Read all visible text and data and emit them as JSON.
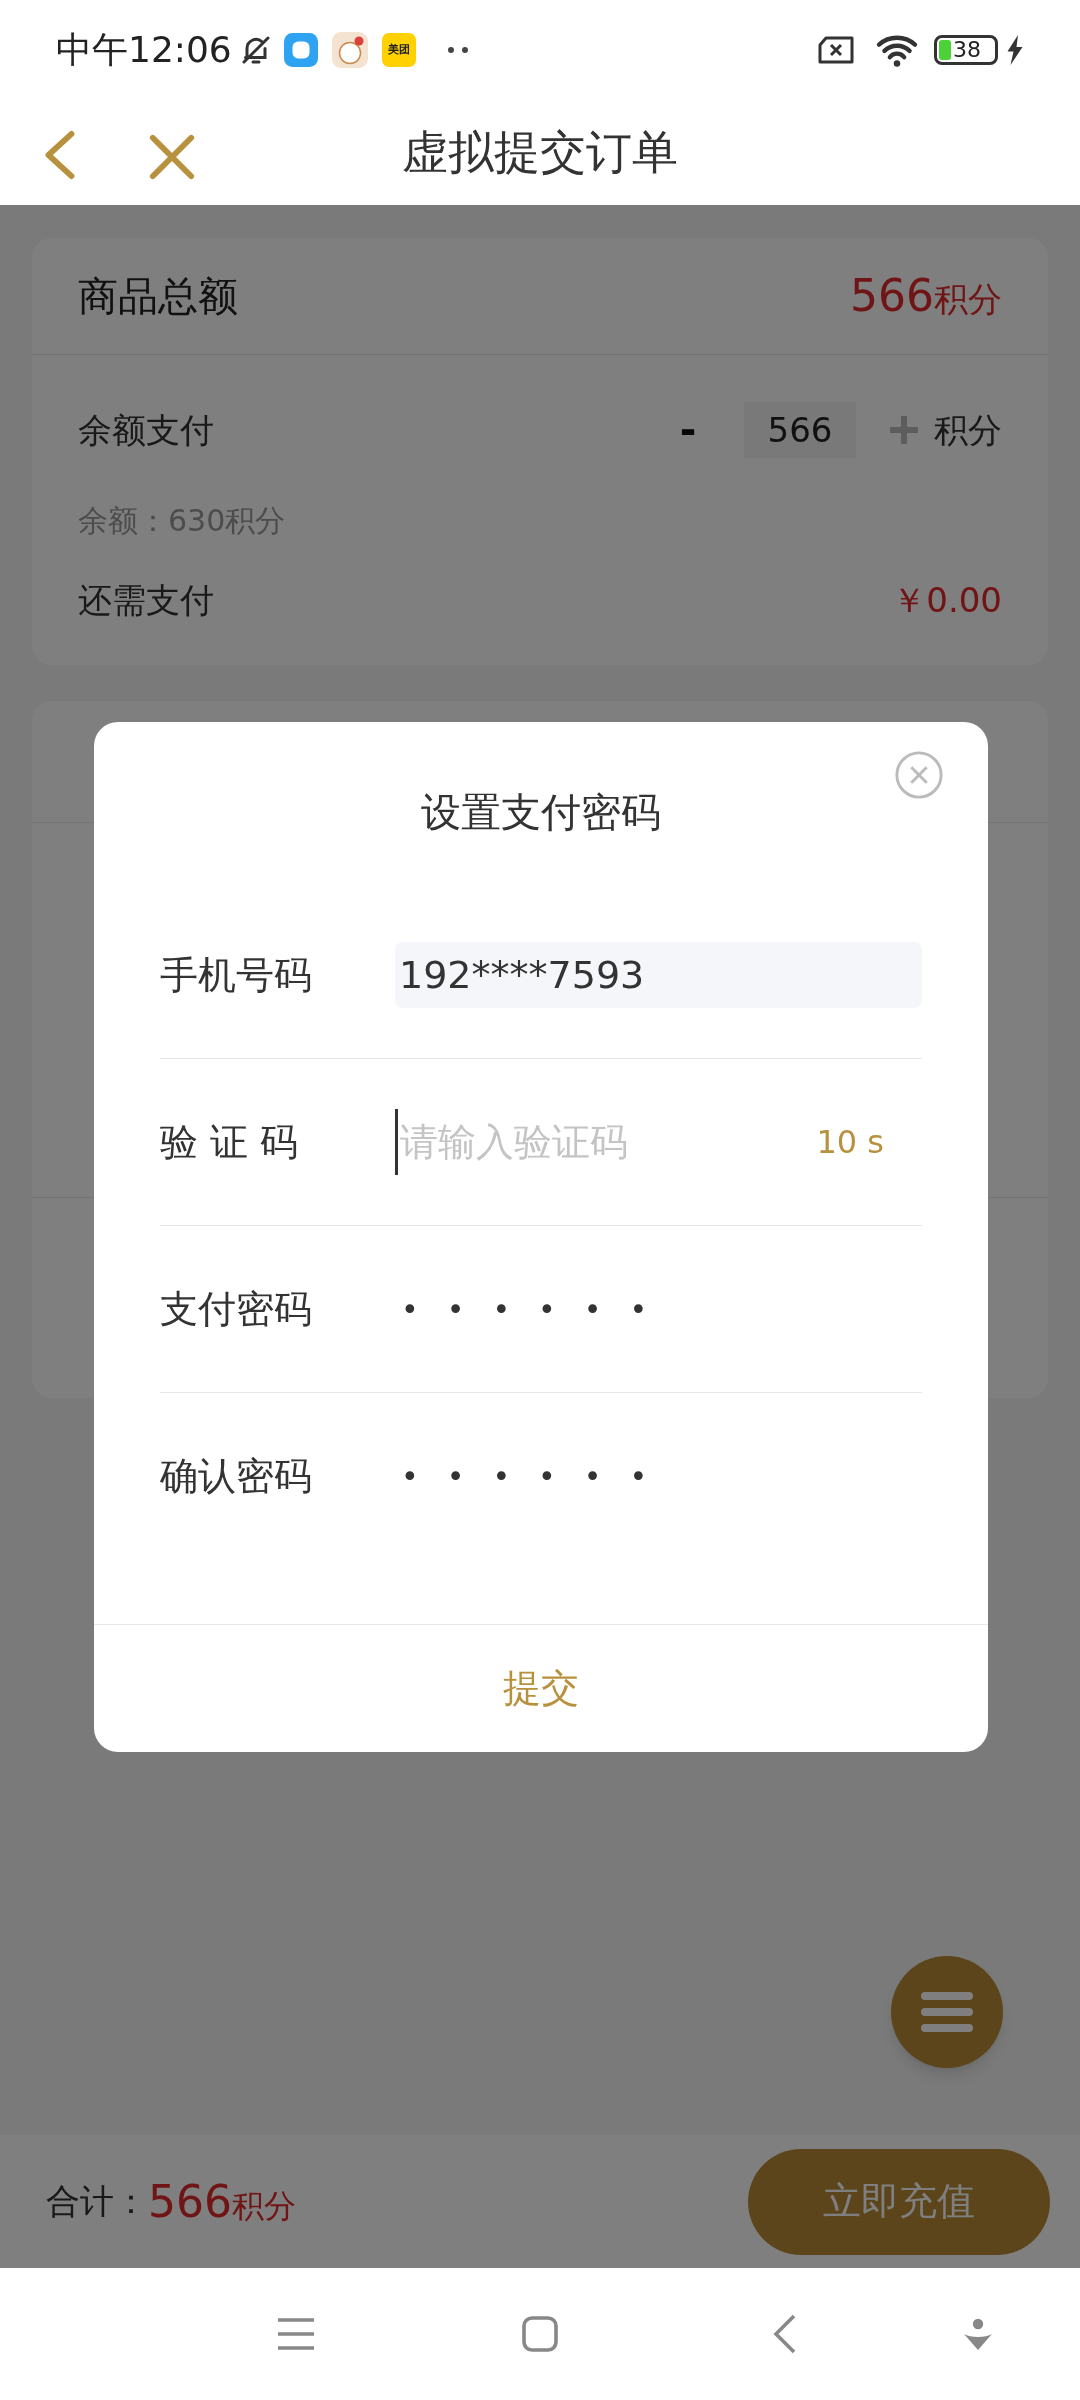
{
  "status_bar": {
    "time": "中午12:06",
    "app_label": "美团",
    "battery": "38"
  },
  "header": {
    "title": "虚拟提交订单"
  },
  "summary": {
    "total_label": "商品总额",
    "total_value": "566",
    "total_unit": "积分",
    "balance_pay_label": "余额支付",
    "minus": "-",
    "amount": "566",
    "unit": "积分",
    "balance_note": "余额：630积分",
    "remaining_label": "还需支付",
    "remaining_value": "￥0.00"
  },
  "dialog": {
    "title": "设置支付密码",
    "fields": [
      {
        "kind": "text",
        "label": "手机号码",
        "value": "192****7593"
      },
      {
        "kind": "code",
        "label": "验 证 码",
        "placeholder": "请输入验证码",
        "countdown": "10 s"
      },
      {
        "kind": "password",
        "label": "支付密码",
        "value": "••••••"
      },
      {
        "kind": "password",
        "label": "确认密码",
        "value": "••••••"
      }
    ],
    "submit": "提交"
  },
  "footer": {
    "total_label": "合计：",
    "total_value": "566",
    "total_unit": "积分",
    "recharge": "立即充值"
  }
}
